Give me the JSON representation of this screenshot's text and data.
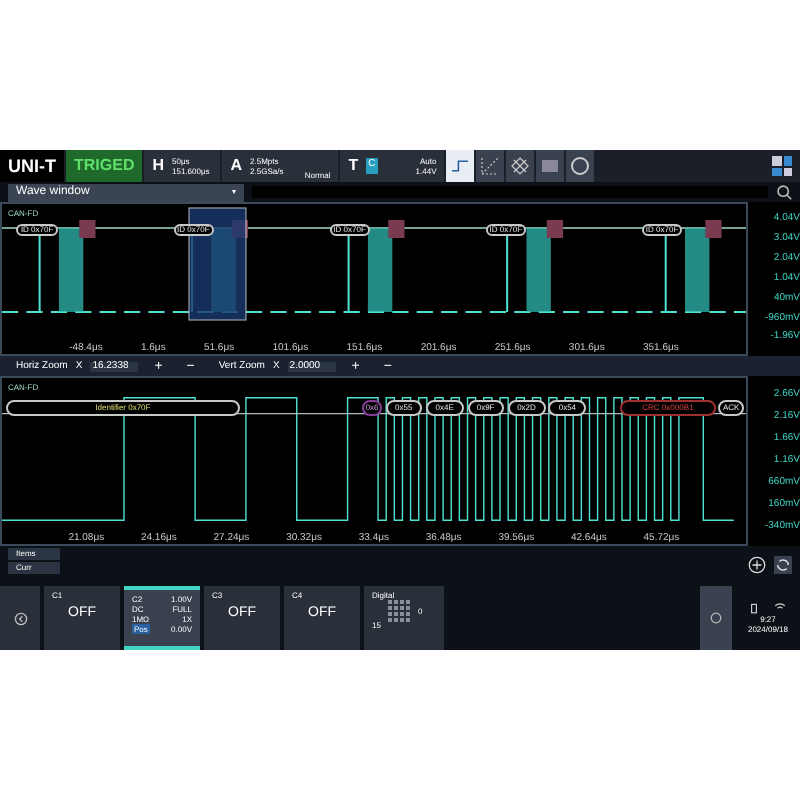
{
  "top_bar": {
    "logo": "UNI-T",
    "trigger_status": "TRIGED",
    "horizontal": {
      "label": "H",
      "scale": "50μs",
      "position": "151.600μs"
    },
    "acquisition": {
      "label": "A",
      "depth": "2.5Mpts",
      "sample_rate": "2.5GSa/s",
      "mode": "Normal"
    },
    "trigger": {
      "label": "T",
      "source": "C",
      "mode": "Auto",
      "level": "1.44V"
    }
  },
  "wave_window": {
    "title": "Wave window",
    "caret": "▾"
  },
  "overview": {
    "bus_label": "CAN-FD",
    "frames": [
      "ID 0x70F",
      "ID 0x70F",
      "ID 0x70F",
      "ID 0x70F",
      "ID 0x70F"
    ],
    "voltage_labels": [
      "4.04V",
      "3.04V",
      "2.04V",
      "1.04V",
      "40mV",
      "-960mV",
      "-1.96V"
    ],
    "time_labels": [
      "-48.4μs",
      "1.6μs",
      "51.6μs",
      "101.6μs",
      "151.6μs",
      "201.6μs",
      "251.6μs",
      "301.6μs",
      "351.6μs"
    ]
  },
  "zoom_controls": [
    {
      "label": "Horiz Zoom",
      "multiplier": "X",
      "value": "16.2338",
      "plus": "+",
      "minus": "−"
    },
    {
      "label": "Vert Zoom",
      "multiplier": "X",
      "value": "2.0000",
      "plus": "+",
      "minus": "−"
    }
  ],
  "zoom_view": {
    "bus_label": "CAN-FD",
    "fields": [
      {
        "kind": "id",
        "text": "Identifier 0x70F"
      },
      {
        "kind": "dlc",
        "text": "0x6"
      },
      {
        "kind": "data",
        "text": "0x55"
      },
      {
        "kind": "data",
        "text": "0x4E"
      },
      {
        "kind": "data",
        "text": "0x9F"
      },
      {
        "kind": "data",
        "text": "0x2D"
      },
      {
        "kind": "data",
        "text": "0x54"
      },
      {
        "kind": "crc",
        "text": "CRC 0x000B1"
      },
      {
        "kind": "ack",
        "text": "ACK"
      }
    ],
    "voltage_labels": [
      "2.66V",
      "2.16V",
      "1.66V",
      "1.16V",
      "660mV",
      "160mV",
      "-340mV"
    ],
    "time_labels": [
      "21.08μs",
      "24.16μs",
      "27.24μs",
      "30.32μs",
      "33.4μs",
      "36.48μs",
      "39.56μs",
      "42.64μs",
      "45.72μs"
    ]
  },
  "items_panel": [
    "Items",
    "Curr"
  ],
  "channels": [
    {
      "name": "C1",
      "selected": false,
      "status": "OFF"
    },
    {
      "name": "C2",
      "selected": true,
      "scale": "1.00V",
      "details": [
        {
          "label": "DC",
          "value": "FULL"
        },
        {
          "label": "1MΩ",
          "value": "1X"
        },
        {
          "label": "Pos",
          "value": "0.00V"
        }
      ]
    },
    {
      "name": "C3",
      "selected": false,
      "status": "OFF"
    },
    {
      "name": "C4",
      "selected": false,
      "status": "OFF"
    }
  ],
  "digital": {
    "label": "Digital",
    "high": "0",
    "low": "15"
  },
  "status": {
    "time": "9:27",
    "date": "2024/09/18"
  }
}
